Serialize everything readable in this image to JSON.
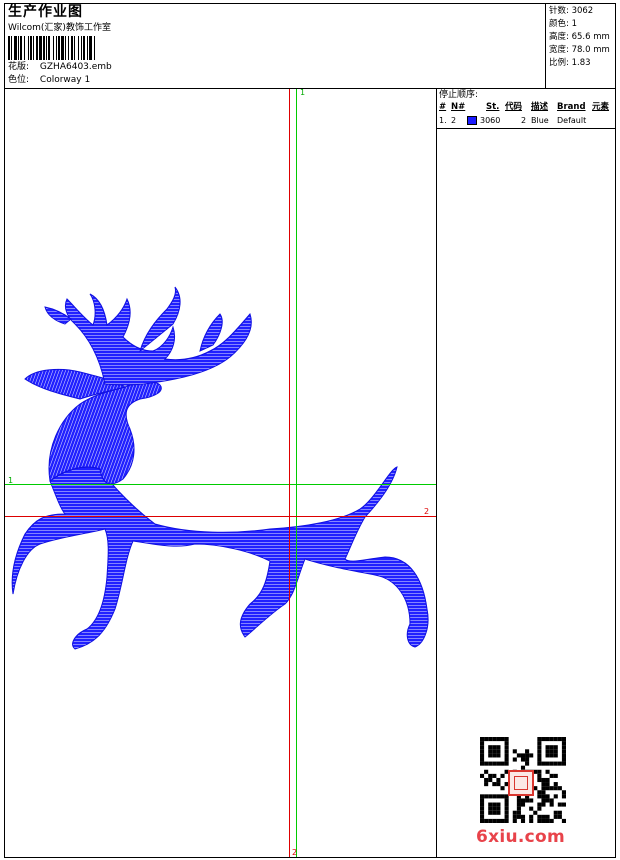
{
  "header": {
    "title": "生产作业图",
    "company": "Wilcom(汇家)教饰工作室",
    "design_label": "花版:",
    "design_value": "GZHA6403.emb",
    "colorway_label": "色位:",
    "colorway_value": "Colorway 1"
  },
  "stats": [
    {
      "label": "针数:",
      "value": "3062"
    },
    {
      "label": "颜色:",
      "value": "1"
    },
    {
      "label": "高度:",
      "value": "65.6 mm"
    },
    {
      "label": "宽度:",
      "value": "78.0 mm"
    },
    {
      "label": "比例:",
      "value": "1.83"
    }
  ],
  "stop_sequence": {
    "title": "停止顺序:",
    "columns": [
      "#",
      "N#",
      "St.",
      "代码",
      "描述",
      "Brand",
      "元素"
    ],
    "rows": [
      {
        "index": "1.",
        "needle": "2",
        "stitches": "3060",
        "code": "2",
        "description": "Blue",
        "brand": "Default",
        "color": "#1a1aff"
      }
    ]
  },
  "axes": {
    "green_top": "1",
    "green_left": "1",
    "red_right": "2",
    "red_bottom": "2"
  },
  "watermark": {
    "text": "6xiu.com"
  },
  "colors": {
    "thread": "#1a1aff",
    "green_axis": "#00cc00",
    "red_axis": "#dd0000"
  }
}
